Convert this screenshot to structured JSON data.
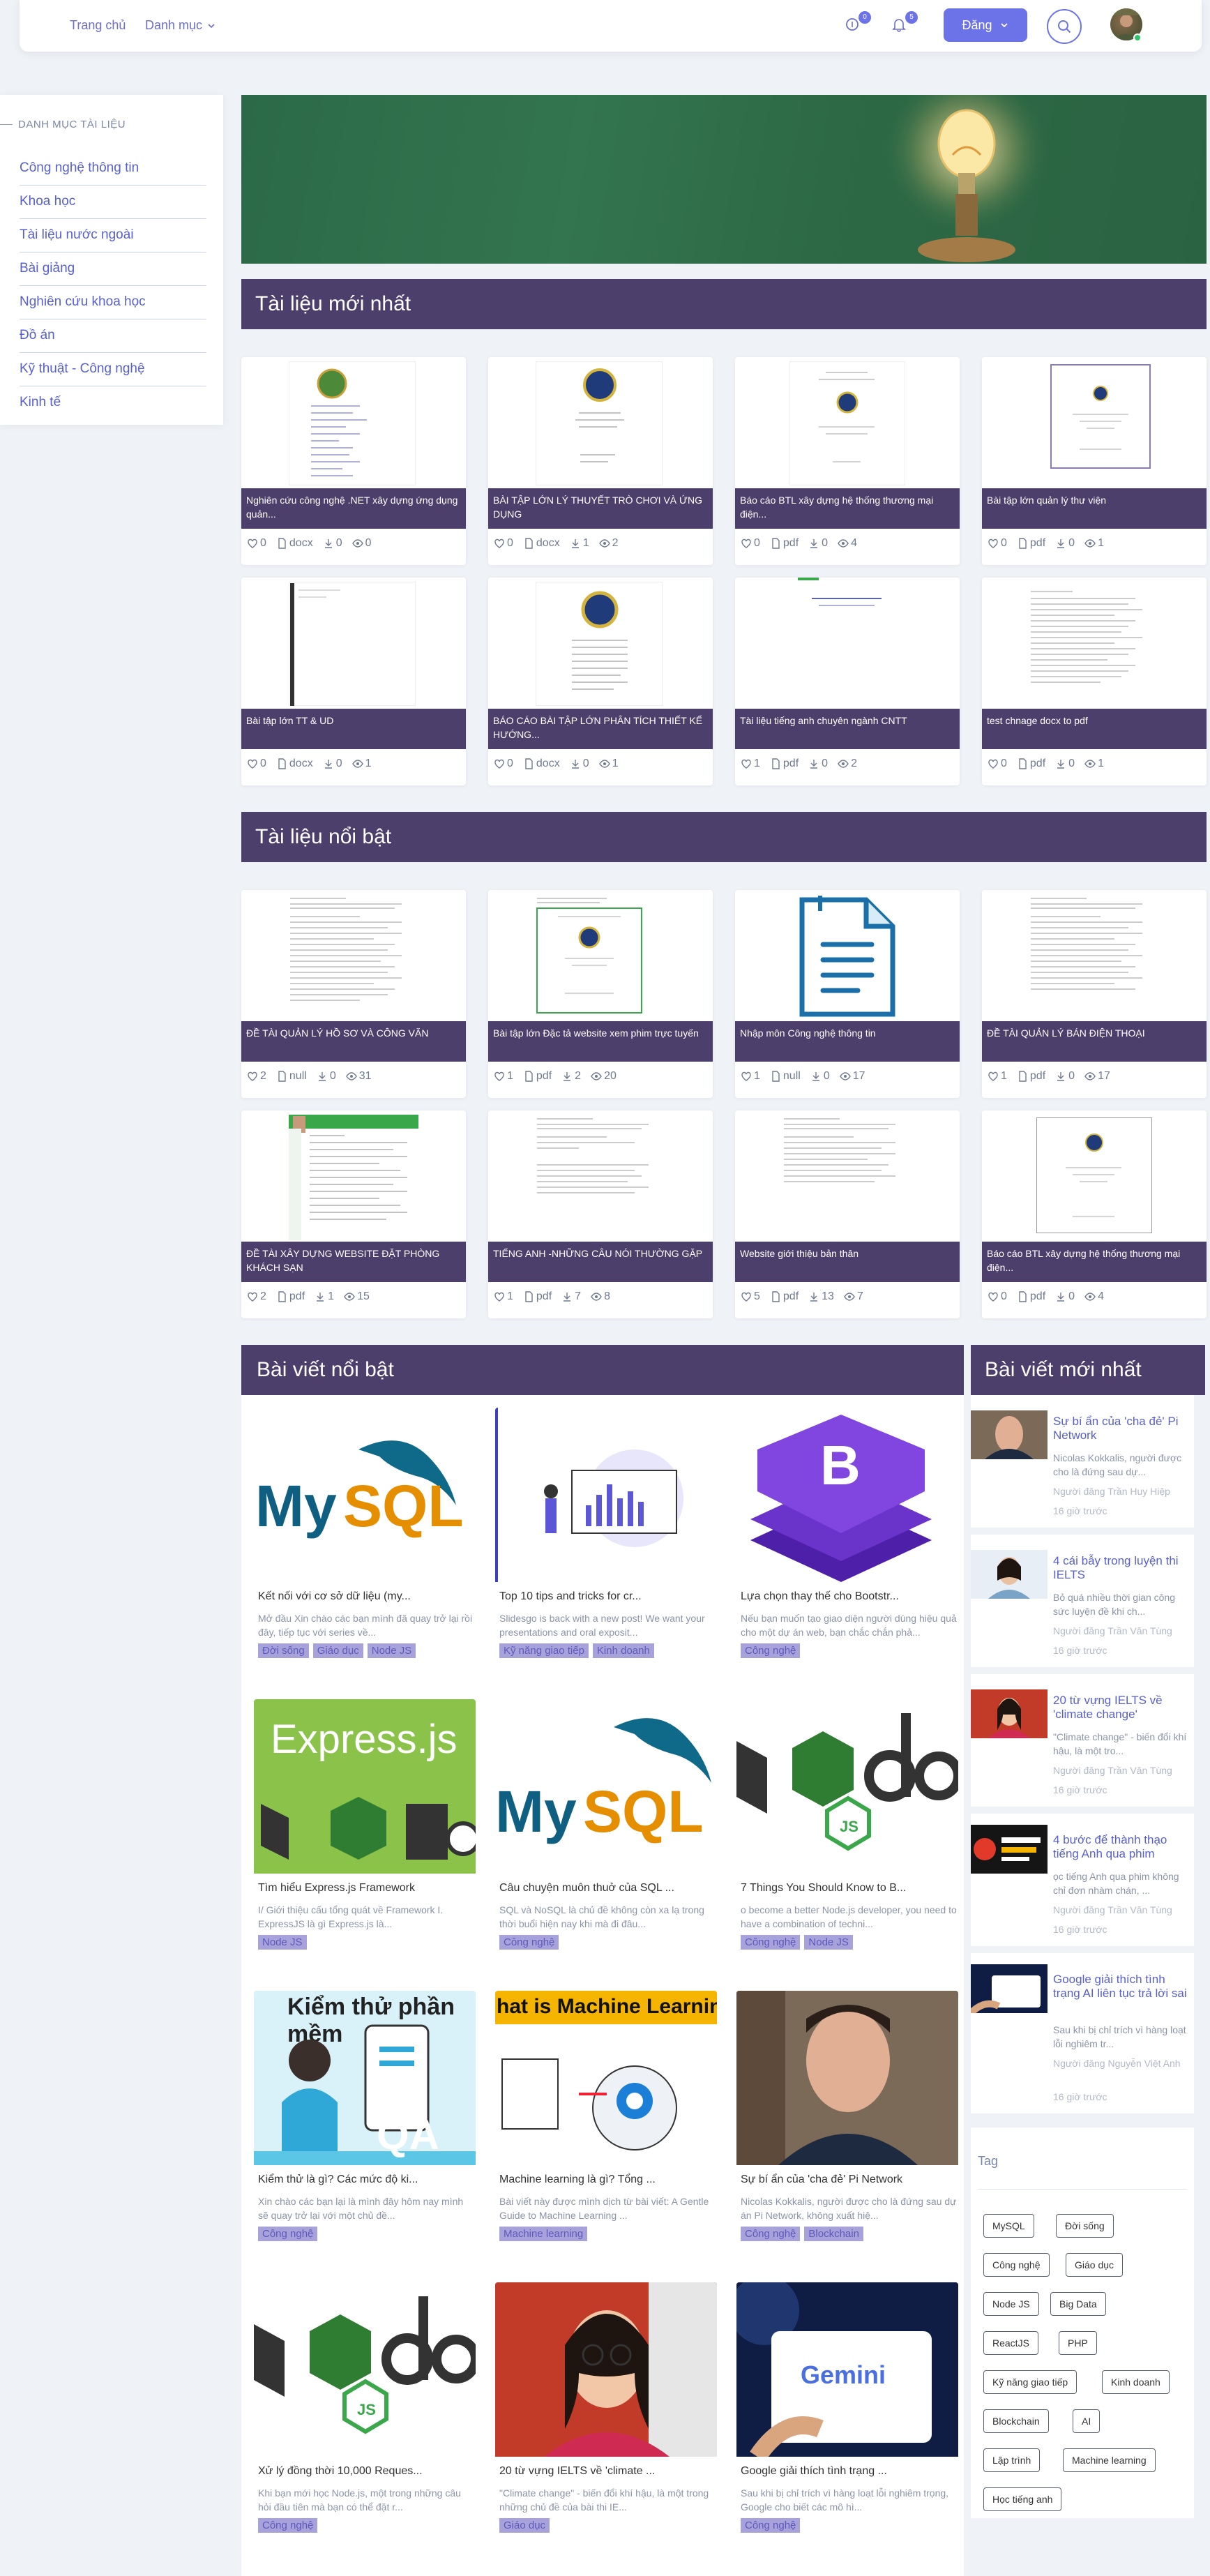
{
  "header": {
    "home": "Trang chủ",
    "category": "Danh mục",
    "badge_1": "0",
    "badge_2": "5",
    "post_button": "Đăng"
  },
  "sidebar": {
    "title": "DANH MỤC TÀI LIỆU",
    "items": [
      "Công nghệ thông tin",
      "Khoa học",
      "Tài liệu nước ngoài",
      "Bài giảng",
      "Nghiên cứu khoa học",
      "Đồ án",
      "Kỹ thuật - Công nghệ",
      "Kinh tế"
    ]
  },
  "sections": {
    "new_docs": "Tài liệu mới nhất",
    "featured_docs": "Tài liệu nổi bật",
    "featured_posts": "Bài viết nổi bật",
    "new_posts": "Bài viết mới nhất",
    "tag": "Tag"
  },
  "new_docs": [
    {
      "title": "Nghiên cứu công nghệ .NET xây dựng ứng dụng quản...",
      "likes": "0",
      "type": "docx",
      "downloads": "0",
      "views": "0"
    },
    {
      "title": "BÀI TẬP LỚN LÝ THUYẾT TRÒ CHƠI VÀ ỨNG DỤNG",
      "likes": "0",
      "type": "docx",
      "downloads": "1",
      "views": "2"
    },
    {
      "title": "Báo cáo BTL xây dựng hệ thống thương mại điện...",
      "likes": "0",
      "type": "pdf",
      "downloads": "0",
      "views": "4"
    },
    {
      "title": "Bài tập lớn quản lý thư viện",
      "likes": "0",
      "type": "pdf",
      "downloads": "0",
      "views": "1"
    },
    {
      "title": "Bài tập lớn TT & UD",
      "likes": "0",
      "type": "docx",
      "downloads": "0",
      "views": "1"
    },
    {
      "title": "BÁO CÁO BÀI TẬP LỚN PHÂN TÍCH THIẾT KẾ HƯỚNG...",
      "likes": "0",
      "type": "docx",
      "downloads": "0",
      "views": "1"
    },
    {
      "title": "Tài liệu tiếng anh chuyên ngành CNTT",
      "likes": "1",
      "type": "pdf",
      "downloads": "0",
      "views": "2"
    },
    {
      "title": "test chnage docx to pdf",
      "likes": "0",
      "type": "pdf",
      "downloads": "0",
      "views": "1"
    }
  ],
  "featured_docs": [
    {
      "title": "ĐỀ TÀI QUẢN LÝ HỒ SƠ VÀ CÔNG VĂN",
      "likes": "2",
      "type": "null",
      "downloads": "0",
      "views": "31"
    },
    {
      "title": "Bài tập lớn Đặc tả website xem phim trực tuyến",
      "likes": "1",
      "type": "pdf",
      "downloads": "2",
      "views": "20"
    },
    {
      "title": "Nhập môn Công nghệ thông tin",
      "likes": "1",
      "type": "null",
      "downloads": "0",
      "views": "17"
    },
    {
      "title": "ĐỀ TÀI QUẢN LÝ BÁN ĐIỆN THOẠI",
      "likes": "1",
      "type": "pdf",
      "downloads": "0",
      "views": "17"
    },
    {
      "title": "ĐỀ TÀI XÂY DỰNG WEBSITE ĐẶT PHÒNG KHÁCH SẠN",
      "likes": "2",
      "type": "pdf",
      "downloads": "1",
      "views": "15"
    },
    {
      "title": "TIẾNG ANH -NHỮNG CÂU NÓI THƯỜNG GẶP",
      "likes": "1",
      "type": "pdf",
      "downloads": "7",
      "views": "8"
    },
    {
      "title": "Website giới thiệu bản thân",
      "likes": "5",
      "type": "pdf",
      "downloads": "13",
      "views": "7"
    },
    {
      "title": "Báo cáo BTL xây dựng hệ thống thương mại điện...",
      "likes": "0",
      "type": "pdf",
      "downloads": "0",
      "views": "4"
    }
  ],
  "logo_text": {
    "express": "Express.js",
    "qa_title": "Kiểm thử phần mềm",
    "qa": "QA",
    "ml": "hat is Machine Learning",
    "gemini": "Gemini"
  },
  "featured_posts": [
    {
      "title": "Kết nối với cơ sở dữ liệu (my...",
      "excerpt": "Mở đầu Xin chào các bạn mình đã quay trở lại rồi đây, tiếp tục với series về...",
      "tags": [
        "Đời sống",
        "Giáo dục",
        "Node JS"
      ]
    },
    {
      "title": "Top 10 tips and tricks for cr...",
      "excerpt": "Slidesgo is back with a new post! We want your presentations and oral exposit...",
      "tags": [
        "Kỹ năng giao tiếp",
        "Kinh doanh"
      ]
    },
    {
      "title": "Lựa chọn thay thế cho Bootstr...",
      "excerpt": "Nếu bạn muốn tạo giao diện người dùng hiệu quả cho một dự án web, bạn chắc chắn phả...",
      "tags": [
        "Công nghệ"
      ]
    },
    {
      "title": "Tìm hiểu Express.js Framework",
      "excerpt": "I/ Giới thiệu cấu tổng quát về Framework I. ExpressJS là gì Express.js là...",
      "tags": [
        "Node JS"
      ]
    },
    {
      "title": "Câu chuyện muôn thuở của SQL ...",
      "excerpt": "SQL và NoSQL là chủ đề không còn xa lạ trong thời buổi hiện nay khi mà đi đâu...",
      "tags": [
        "Công nghệ"
      ]
    },
    {
      "title": "7 Things You Should Know to B...",
      "excerpt": "o become a better Node.js developer, you need to have a combination of techni...",
      "tags": [
        "Công nghệ",
        "Node JS"
      ]
    },
    {
      "title": "Kiểm thử là gì? Các mức độ ki...",
      "excerpt": "Xin chào các bạn lại là mình đây  hôm nay mình sẽ quay trở lại với một chủ đề...",
      "tags": [
        "Công nghệ"
      ]
    },
    {
      "title": "Machine learning là gì? Tổng ...",
      "excerpt": "Bài viết này được mình dịch từ bài viết: A Gentle Guide to Machine Learning ...",
      "tags": [
        "Machine learning"
      ]
    },
    {
      "title": "Sự bí ẩn của 'cha đẻ' Pi Network",
      "excerpt": "Nicolas Kokkalis, người được cho là đứng sau dự án Pi Network, không xuất hiệ...",
      "tags": [
        "Công nghệ",
        "Blockchain"
      ]
    },
    {
      "title": "Xử lý đồng thời 10,000 Reques...",
      "excerpt": "Khi bạn mới học Node.js, một trong những câu hỏi đầu tiên mà bạn có thể đặt r...",
      "tags": [
        "Công nghệ"
      ]
    },
    {
      "title": "20 từ vựng IELTS về 'climate ...",
      "excerpt": "\"Climate change\" - biến đổi khí hậu, là một trong những chủ đề của bài thi IE...",
      "tags": [
        "Giáo dục"
      ]
    },
    {
      "title": "Google giải thích tình trạng ...",
      "excerpt": "Sau khi bị chỉ trích vì hàng loạt lỗi nghiêm trọng, Google cho biết các mô hì...",
      "tags": [
        "Công nghệ"
      ]
    }
  ],
  "new_posts": [
    {
      "title": "Sự bí ẩn của 'cha đẻ' Pi Network",
      "excerpt": "Nicolas Kokkalis, người được cho là đứng sau dự...",
      "author": "Người đăng Trần Huy Hiệp",
      "time": "16 giờ trước"
    },
    {
      "title": "4 cái bẫy trong luyện thi IELTS",
      "excerpt": "Bỏ quá nhiều thời gian công sức luyện đề khi ch...",
      "author": "Người đăng Trần Văn Tùng",
      "time": "16 giờ trước"
    },
    {
      "title": "20 từ vựng IELTS về 'climate change'",
      "excerpt": "\"Climate change\" - biến đổi khí hậu, là một tro...",
      "author": "Người đăng Trần Văn Tùng",
      "time": "16 giờ trước"
    },
    {
      "title": "4 bước để thành thạo tiếng Anh qua phim",
      "excerpt": "ọc tiếng Anh qua phim không chỉ đơn nhàm chán, ...",
      "author": "Người đăng Trần Văn Tùng",
      "time": "16 giờ trước"
    },
    {
      "title": "Google giải thích tình trạng AI liên tục trả lời sai",
      "excerpt": "Sau khi bị chỉ trích vì hàng loạt lỗi nghiêm tr...",
      "author": "Người đăng Nguyễn Việt Anh",
      "time": "16 giờ trước"
    }
  ],
  "tags": [
    "MySQL",
    "Đời sống",
    "Công nghệ",
    "Giáo dục",
    "Node JS",
    "Big Data",
    "ReactJS",
    "PHP",
    "Kỹ năng giao tiếp",
    "Kinh doanh",
    "Blockchain",
    "AI",
    "Lập trình",
    "Machine learning",
    "Học tiếng anh"
  ],
  "colors": {
    "accent": "#6c73e8",
    "section": "#4c3f6b",
    "link": "#5860cc",
    "chalkboard": "#2f6d49"
  }
}
